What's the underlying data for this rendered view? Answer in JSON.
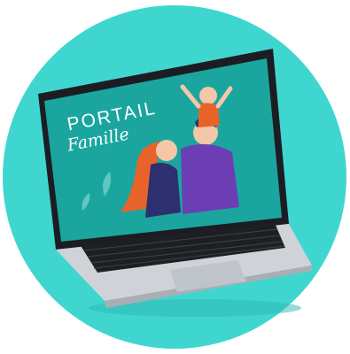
{
  "scene": {
    "description_hidden": false,
    "colors": {
      "circle": "#3fd6d0",
      "screen": "#1aa69f",
      "laptop_body": "#cfd3d8",
      "keyboard": "#1d1f23",
      "person_hair": "#e8632a",
      "shirt_navy": "#2d2f6e",
      "shirt_purple": "#6b3fb3"
    },
    "screen_text": {
      "title": "PORTAIL",
      "script": "Famille"
    }
  }
}
